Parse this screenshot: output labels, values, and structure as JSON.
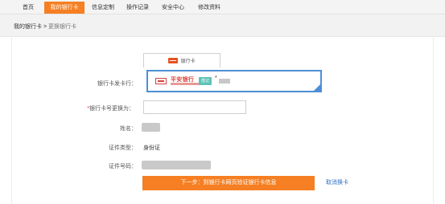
{
  "nav": {
    "items": [
      {
        "label": "首页",
        "active": false
      },
      {
        "label": "我的银行卡",
        "active": true
      },
      {
        "label": "信息定制",
        "active": false
      },
      {
        "label": "操作记录",
        "active": false
      },
      {
        "label": "安全中心",
        "active": false
      },
      {
        "label": "修改资料",
        "active": false
      }
    ]
  },
  "breadcrumb": {
    "parent": "我的银行卡",
    "separator": ">",
    "current": "更换银行卡"
  },
  "tab": {
    "label": "银行卡"
  },
  "form": {
    "bank_label": "银行卡发卡行：",
    "bank_name": "平安银行",
    "card_type_badge": "借记",
    "card_number_prefix": "*",
    "new_card_required_mark": "*",
    "new_card_label": "银行卡号更换为：",
    "new_card_value": "",
    "name_label": "姓名：",
    "id_type_label": "证件类型：",
    "id_type_value": "身份证",
    "id_number_label": "证件号码："
  },
  "actions": {
    "next_label": "下一步：到银行卡网页验证银行卡信息",
    "cancel_label": "取消换卡"
  },
  "colors": {
    "accent": "#f57f22",
    "link": "#2f6fc1",
    "selected_border": "#4d8fd6"
  }
}
